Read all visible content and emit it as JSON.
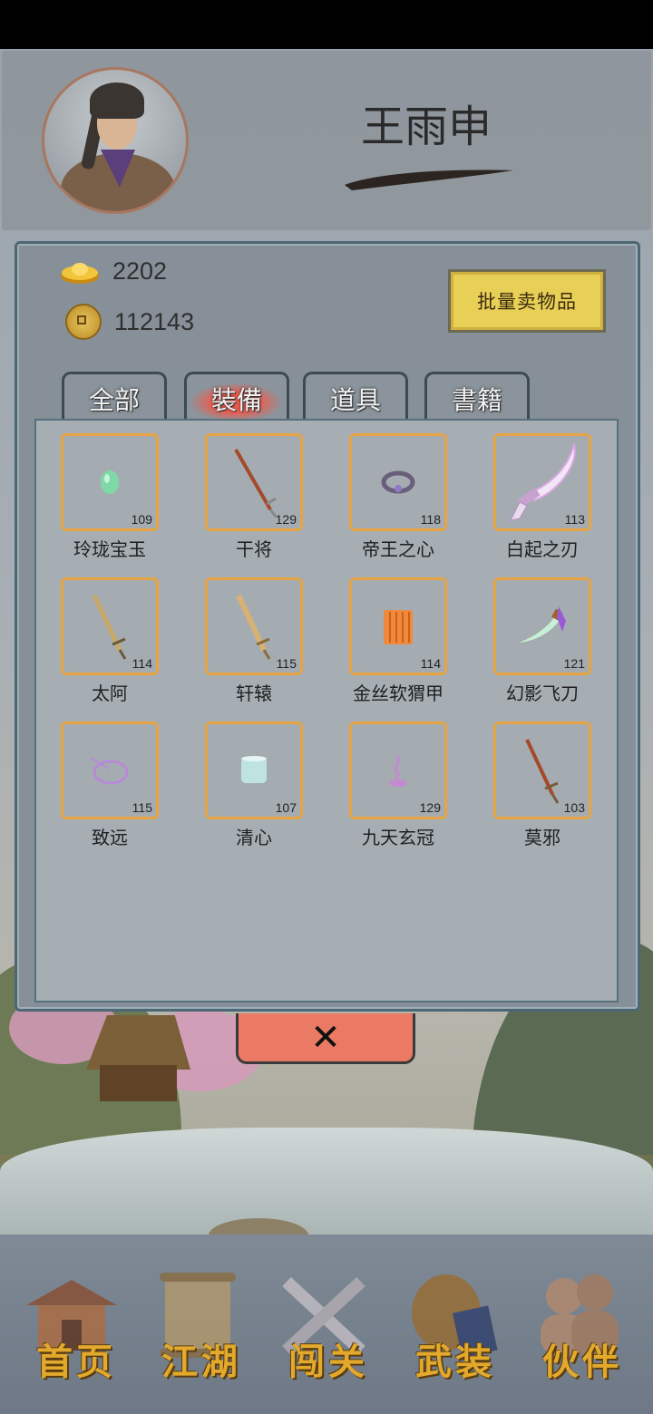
{
  "player": {
    "name": "王雨申"
  },
  "currency": {
    "gold_ingots": "2202",
    "coins": "112143"
  },
  "sell_button": "批量卖物品",
  "tabs": [
    {
      "label": "全部",
      "active": false
    },
    {
      "label": "裝備",
      "active": true
    },
    {
      "label": "道具",
      "active": false
    },
    {
      "label": "書籍",
      "active": false
    }
  ],
  "items": [
    {
      "name": "玲珑宝玉",
      "level": "109",
      "icon": "jade-icon"
    },
    {
      "name": "干将",
      "level": "129",
      "icon": "sword-icon"
    },
    {
      "name": "帝王之心",
      "level": "118",
      "icon": "ring-icon"
    },
    {
      "name": "白起之刃",
      "level": "113",
      "icon": "sabre-icon"
    },
    {
      "name": "太阿",
      "level": "114",
      "icon": "sword-icon"
    },
    {
      "name": "轩辕",
      "level": "115",
      "icon": "sword-icon"
    },
    {
      "name": "金丝软猬甲",
      "level": "114",
      "icon": "armor-icon"
    },
    {
      "name": "幻影飞刀",
      "level": "121",
      "icon": "dagger-icon"
    },
    {
      "name": "致远",
      "level": "115",
      "icon": "bracelet-icon"
    },
    {
      "name": "清心",
      "level": "107",
      "icon": "bracer-icon"
    },
    {
      "name": "九天玄冠",
      "level": "129",
      "icon": "hairpin-icon"
    },
    {
      "name": "莫邪",
      "level": "103",
      "icon": "sword-icon"
    }
  ],
  "close_button": "✕",
  "nav": [
    {
      "label": "首页",
      "icon": "house-icon"
    },
    {
      "label": "江湖",
      "icon": "scroll-icon"
    },
    {
      "label": "闯关",
      "icon": "crossed-swords-icon"
    },
    {
      "label": "武装",
      "icon": "armor-icon"
    },
    {
      "label": "伙伴",
      "icon": "companions-icon"
    }
  ],
  "colors": {
    "slot_border": "#e8a443",
    "tab_active": "#ef5b4e",
    "nav_label": "#e3a92c",
    "sell_button": "#e8cf55"
  }
}
